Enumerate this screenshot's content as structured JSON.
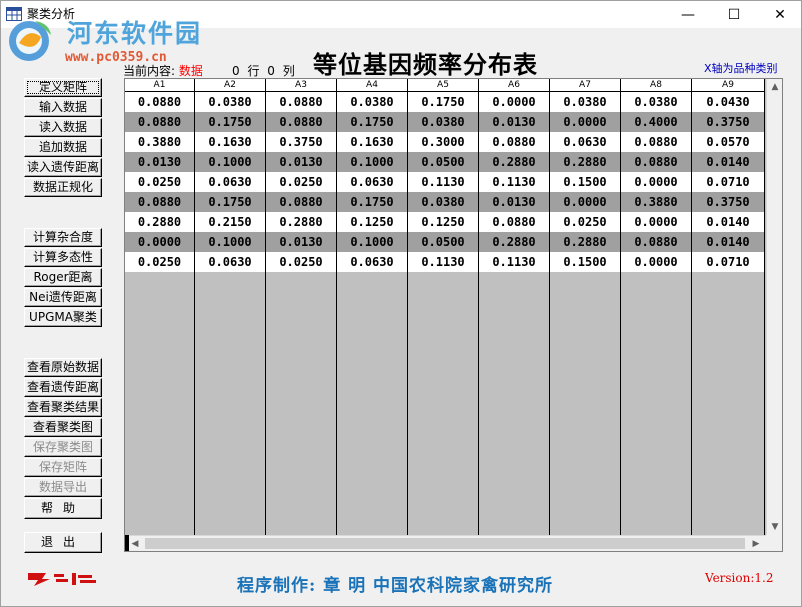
{
  "window": {
    "title": "聚类分析",
    "minimize_glyph": "—",
    "maximize_glyph": "☐",
    "close_glyph": "✕"
  },
  "watermark": {
    "name": "河东软件园",
    "url": "www.pc0359.cn"
  },
  "header": {
    "current_label": "当前内容:",
    "current_value": "数据",
    "rows_cols": "0 行 0 列",
    "title": "等位基因频率分布表",
    "axis_note": "X轴为品种类别"
  },
  "sidebar": {
    "group1": [
      "定义矩阵",
      "输入数据",
      "读入数据",
      "追加数据",
      "读入遗传距离",
      "数据正规化"
    ],
    "group2": [
      "计算杂合度",
      "计算多态性",
      "Roger距离",
      "Nei遗传距离",
      "UPGMA聚类"
    ],
    "group3": [
      "查看原始数据",
      "查看遗传距离",
      "查看聚类结果",
      "查看聚类图",
      "保存聚类图",
      "保存矩阵",
      "数据导出"
    ],
    "group3_disabled": [
      false,
      false,
      false,
      false,
      true,
      true,
      true
    ],
    "help": "帮助",
    "exit": "退出"
  },
  "grid": {
    "columns": [
      "A1",
      "A2",
      "A3",
      "A4",
      "A5",
      "A6",
      "A7",
      "A8",
      "A9"
    ],
    "rows": [
      [
        "0.0880",
        "0.0380",
        "0.0880",
        "0.0380",
        "0.1750",
        "0.0000",
        "0.0380",
        "0.0380",
        "0.0430"
      ],
      [
        "0.0880",
        "0.1750",
        "0.0880",
        "0.1750",
        "0.0380",
        "0.0130",
        "0.0000",
        "0.4000",
        "0.3750"
      ],
      [
        "0.3880",
        "0.1630",
        "0.3750",
        "0.1630",
        "0.3000",
        "0.0880",
        "0.0630",
        "0.0880",
        "0.0570"
      ],
      [
        "0.0130",
        "0.1000",
        "0.0130",
        "0.1000",
        "0.0500",
        "0.2880",
        "0.2880",
        "0.0880",
        "0.0140"
      ],
      [
        "0.0250",
        "0.0630",
        "0.0250",
        "0.0630",
        "0.1130",
        "0.1130",
        "0.1500",
        "0.0000",
        "0.0710"
      ],
      [
        "0.0880",
        "0.1750",
        "0.0880",
        "0.1750",
        "0.0380",
        "0.0130",
        "0.0000",
        "0.3880",
        "0.3750"
      ],
      [
        "0.2880",
        "0.2150",
        "0.2880",
        "0.1250",
        "0.1250",
        "0.0880",
        "0.0250",
        "0.0000",
        "0.0140"
      ],
      [
        "0.0000",
        "0.1000",
        "0.0130",
        "0.1000",
        "0.0500",
        "0.2880",
        "0.2880",
        "0.0880",
        "0.0140"
      ],
      [
        "0.0250",
        "0.0630",
        "0.0250",
        "0.0630",
        "0.1130",
        "0.1130",
        "0.1500",
        "0.0000",
        "0.0710"
      ]
    ]
  },
  "footer": {
    "author": "程序制作: 章 明    中国农科院家禽研究所",
    "version": "Version:1.2",
    "logo_text": "注册"
  },
  "colors": {
    "row_light": "#ffffff",
    "row_dark": "#a0a0a0",
    "grid_bg": "#c0c0c0",
    "author_blue": "#1a73b8",
    "version_red": "#e00000",
    "axis_note_blue": "#0000c0"
  }
}
